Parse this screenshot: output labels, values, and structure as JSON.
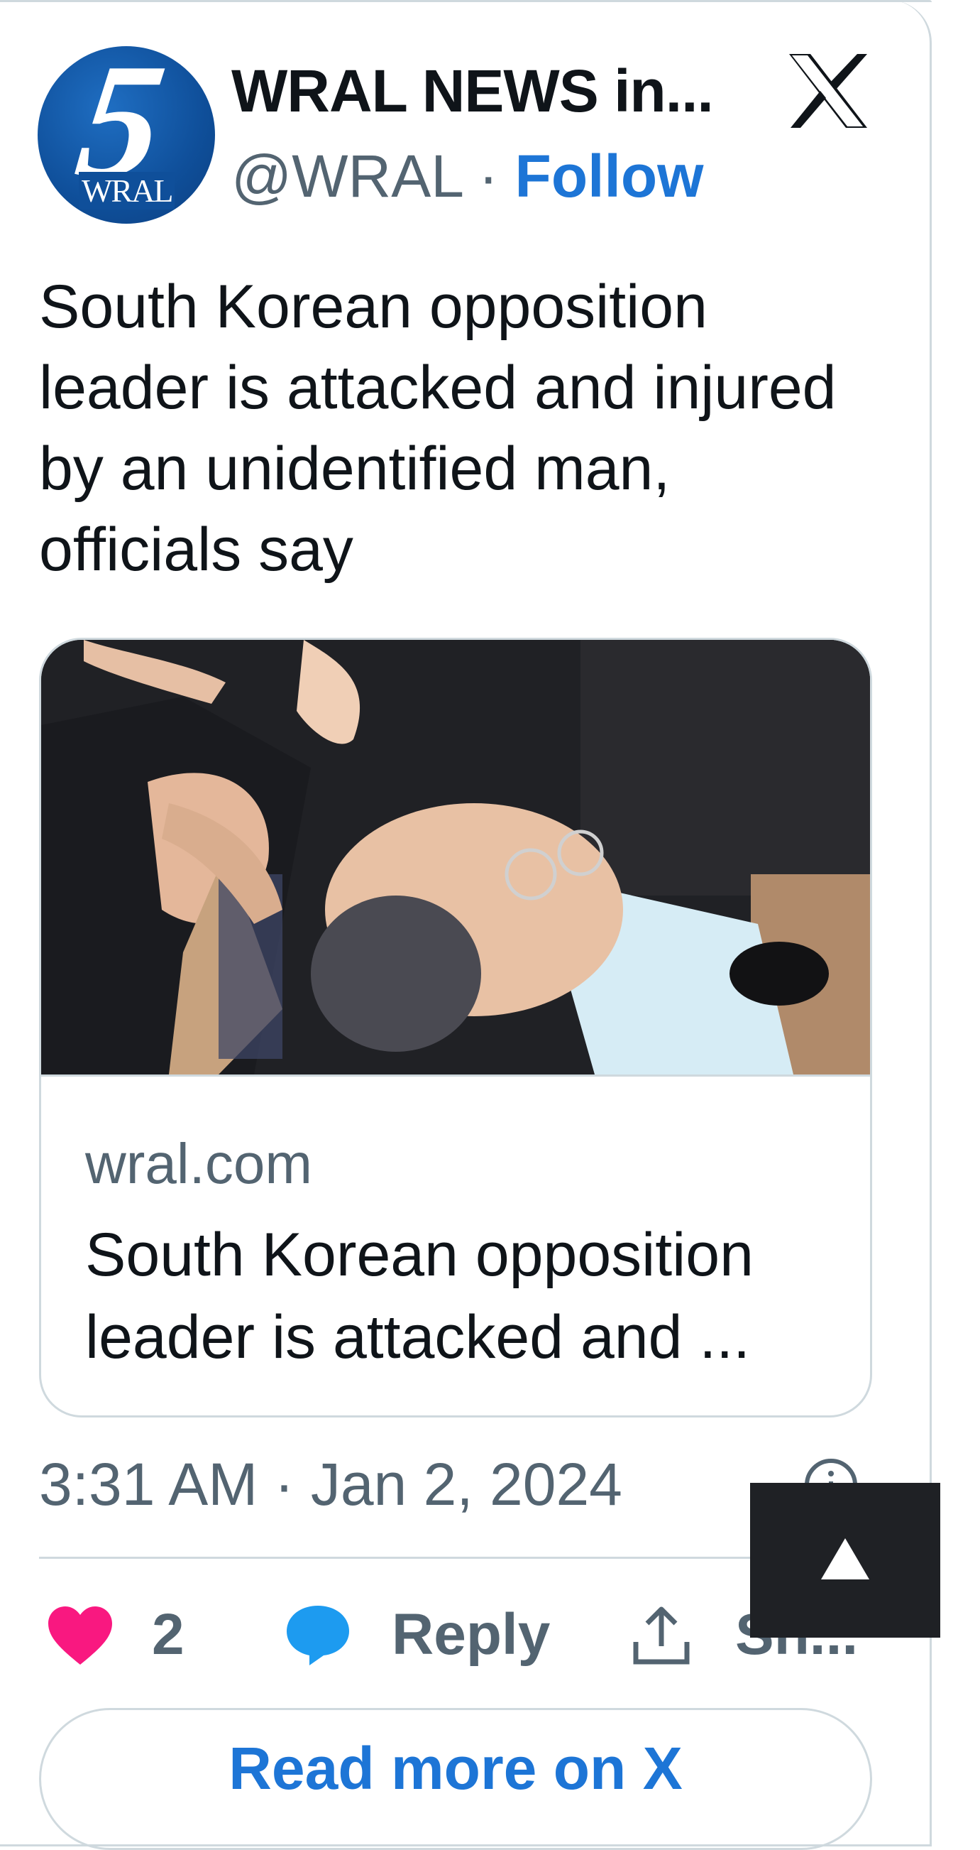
{
  "header": {
    "avatar_digit": "5",
    "avatar_wordmark": "WRAL",
    "display_name": "WRAL NEWS in...",
    "handle": "@WRAL",
    "separator": "·",
    "follow_label": "Follow",
    "platform_icon": "x-logo-icon"
  },
  "tweet": {
    "text": "South Korean opposition leader is attacked and injured by an unidentified man, officials say"
  },
  "link_card": {
    "image_icon": "news-photo",
    "domain": "wral.com",
    "title": "South Korean opposition leader is attacked and ..."
  },
  "meta": {
    "timestamp": "3:31 AM · Jan 2, 2024",
    "info_icon": "info-icon"
  },
  "actions": {
    "like_count": "2",
    "reply_label": "Reply",
    "share_label": "Sh..."
  },
  "footer": {
    "read_more_label": "Read more on X"
  },
  "colors": {
    "accent": "#1d75d6",
    "like": "#f91880",
    "reply": "#1d9bf0",
    "muted": "#536471",
    "border": "#cfd9de"
  }
}
